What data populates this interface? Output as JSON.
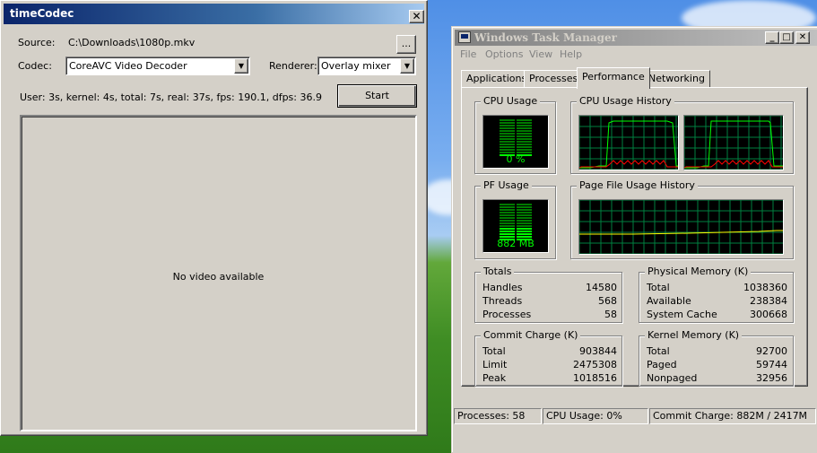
{
  "colors": {
    "graph_green": "#00ff00",
    "graph_bg": "#000000",
    "grid": "#008040",
    "kernel_red": "#ff0000",
    "pf_yellow": "#ffff00",
    "title_active": "#0a246a"
  },
  "timecodec": {
    "title": "timeCodec",
    "source_label": "Source:",
    "source_value": "C:\\Downloads\\1080p.mkv",
    "browse_label": "...",
    "codec_label": "Codec:",
    "codec_value": "CoreAVC Video Decoder",
    "renderer_label": "Renderer:",
    "renderer_value": "Overlay mixer",
    "stats": "User: 3s, kernel: 4s, total: 7s, real: 37s, fps: 190.1, dfps: 36.9",
    "start_label": "Start",
    "video_message": "No video available",
    "close_icon": "close-icon"
  },
  "taskmgr": {
    "title": "Windows Task Manager",
    "menu": [
      "File",
      "Options",
      "View",
      "Help"
    ],
    "tabs": [
      "Applications",
      "Processes",
      "Performance",
      "Networking"
    ],
    "active_tab": "Performance",
    "cpu_usage": {
      "caption": "CPU Usage",
      "value": "0 %",
      "level": 0.0
    },
    "cpu_history": {
      "caption": "CPU Usage History"
    },
    "pf_usage": {
      "caption": "PF Usage",
      "value": "882 MB",
      "level": 0.36
    },
    "pf_history": {
      "caption": "Page File Usage History"
    },
    "totals": {
      "caption": "Totals",
      "rows": [
        {
          "k": "Handles",
          "v": "14580"
        },
        {
          "k": "Threads",
          "v": "568"
        },
        {
          "k": "Processes",
          "v": "58"
        }
      ]
    },
    "physical": {
      "caption": "Physical Memory (K)",
      "rows": [
        {
          "k": "Total",
          "v": "1038360"
        },
        {
          "k": "Available",
          "v": "238384"
        },
        {
          "k": "System Cache",
          "v": "300668"
        }
      ]
    },
    "commit": {
      "caption": "Commit Charge (K)",
      "rows": [
        {
          "k": "Total",
          "v": "903844"
        },
        {
          "k": "Limit",
          "v": "2475308"
        },
        {
          "k": "Peak",
          "v": "1018516"
        }
      ]
    },
    "kernel": {
      "caption": "Kernel Memory (K)",
      "rows": [
        {
          "k": "Total",
          "v": "92700"
        },
        {
          "k": "Paged",
          "v": "59744"
        },
        {
          "k": "Nonpaged",
          "v": "32956"
        }
      ]
    },
    "status": {
      "processes": "Processes: 58",
      "cpu": "CPU Usage: 0%",
      "commit": "Commit Charge: 882M / 2417M"
    }
  }
}
